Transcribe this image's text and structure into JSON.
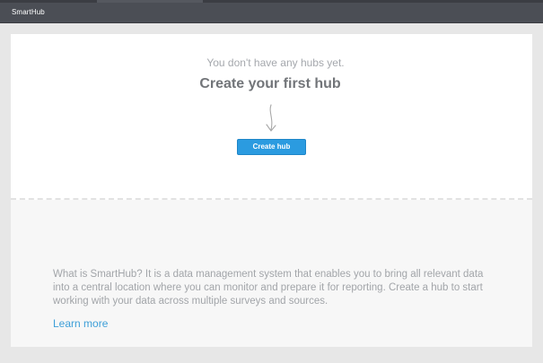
{
  "app": {
    "title": "SmartHub"
  },
  "empty_state": {
    "subtitle": "You don't have any hubs yet.",
    "heading": "Create your first hub",
    "create_button_label": "Create hub"
  },
  "info": {
    "description": "What is SmartHub? It is a data management system that enables you to bring all relevant data into a central location where you can monitor and prepare it for reporting. Create a hub to start working with your data across multiple surveys and sources.",
    "learn_more_label": "Learn more"
  },
  "colors": {
    "accent": "#2b9be0",
    "link": "#3e9fd8",
    "topbar": "#4b4e55"
  },
  "icons": {
    "arrow": "arrow-down-icon"
  }
}
